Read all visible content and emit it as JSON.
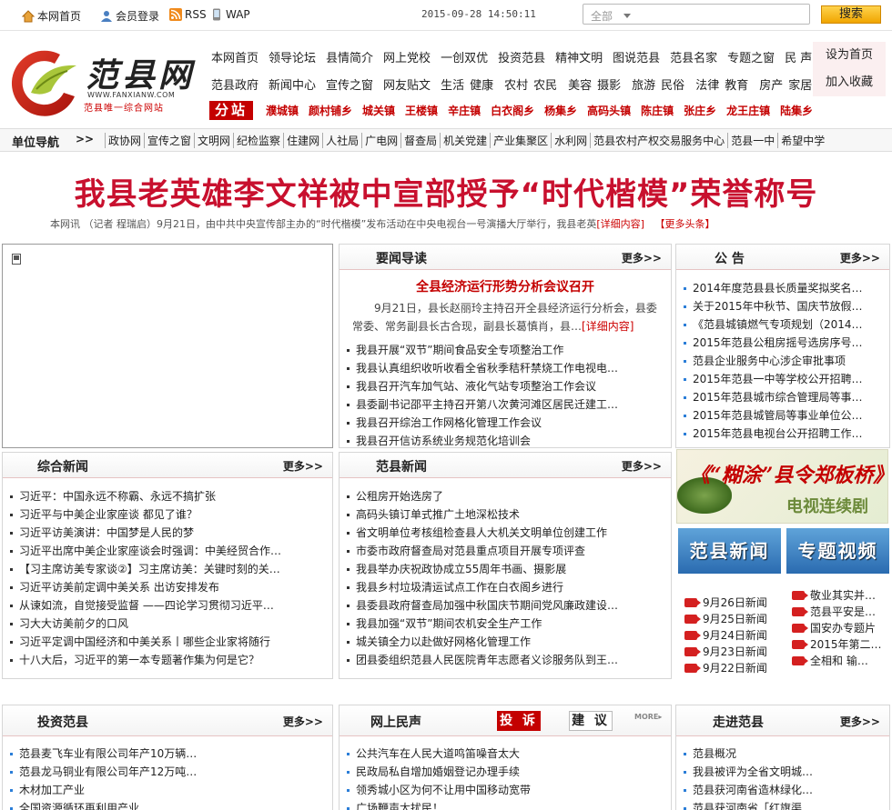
{
  "topbar": {
    "home": "本网首页",
    "login": "会员登录",
    "rss": "RSS",
    "wap": "WAP",
    "datetime": "2015-09-28 14:50:11",
    "search_scope": "全部",
    "search_button": "搜索"
  },
  "logo": {
    "name": "范县网",
    "url": "WWW.FANXIANW.COM",
    "slogan": "范县唯一综合网站"
  },
  "nav": {
    "row1": [
      "本网首页",
      "领导论坛",
      "县情简介",
      "网上党校",
      "一创双优",
      "投资范县",
      "精神文明",
      "图说范县",
      "范县名家",
      "专题之窗",
      "民 声"
    ],
    "row2": [
      "范县政府",
      "新闻中心",
      "宣传之窗",
      "网友贴文",
      "生活",
      "健康",
      "农村",
      "农民",
      "美容",
      "摄影",
      "旅游",
      "民俗",
      "法律",
      "教育",
      "房产",
      "家居"
    ],
    "set_home": "设为首页",
    "add_fav": "加入收藏",
    "fenzhan": "分站",
    "towns": [
      "濮城镇",
      "颜村铺乡",
      "城关镇",
      "王楼镇",
      "辛庄镇",
      "白衣阁乡",
      "杨集乡",
      "高码头镇",
      "陈庄镇",
      "张庄乡",
      "龙王庄镇",
      "陆集乡"
    ]
  },
  "unitnav": {
    "title": "单位导航",
    "arrow": ">>",
    "items": [
      "政协网",
      "宣传之窗",
      "文明网",
      "纪检监察",
      "住建网",
      "人社局",
      "广电网",
      "督查局",
      "机关党建",
      "产业集聚区",
      "水利网",
      "范县农村产权交易服务中心",
      "范县一中",
      "希望中学"
    ]
  },
  "headline": {
    "title": "我县老英雄李文祥被中宣部授予“时代楷模”荣誉称号",
    "summary": "本网讯 （记者 程瑞启）9月21日，由中共中央宣传部主办的“时代楷模”发布活动在中央电视台一号演播大厅举行，我县老英",
    "detail": "[详细内容]",
    "more": "【更多头条】"
  },
  "yaowen": {
    "title": "要闻导读",
    "more": "更多>>",
    "feature_title": "全县经济运行形势分析会议召开",
    "feature_summary": "9月21日，县长赵丽玲主持召开全县经济运行分析会，县委常委、常务副县长古合现，副县长葛慎肖，县…",
    "feature_detail": "[详细内容]",
    "items": [
      "我县开展“双节”期间食品安全专项整治工作",
      "我县认真组织收听收看全省秋季秸秆禁烧工作电视电…",
      "我县召开汽车加气站、液化气站专项整治工作会议",
      "县委副书记邵平主持召开第八次黄河滩区居民迁建工…",
      "我县召开综治工作网格化管理工作会议",
      "我县召开信访系统业务规范化培训会"
    ]
  },
  "gonggao": {
    "title": "公 告",
    "more": "更多>>",
    "items": [
      "2014年度范县县长质量奖拟奖名…",
      "关于2015年中秋节、国庆节放假…",
      "《范县城镇燃气专项规划（2014…",
      "2015年范县公租房摇号选房序号…",
      "范县企业服务中心涉企审批事项",
      "2015年范县一中等学校公开招聘…",
      "2015年范县城市综合管理局等事…",
      "2015年范县城管局等事业单位公…",
      "2015年范县电视台公开招聘工作…"
    ]
  },
  "zonghe": {
    "title": "综合新闻",
    "more": "更多>>",
    "items": [
      "习近平：中国永远不称霸、永远不搞扩张",
      "习近平与中美企业家座谈 都见了谁？",
      "习近平访美演讲：中国梦是人民的梦",
      "习近平出席中美企业家座谈会时强调：中美经贸合作…",
      "【习主席访美专家谈②】习主席访美：关键时刻的关…",
      "习近平访美前定调中美关系 出访安排发布",
      "从谏如流，自觉接受监督 ——四论学习贯彻习近平…",
      "习大大访美前夕的口风",
      "习近平定调中国经济和中美关系丨哪些企业家将随行",
      "十八大后，习近平的第一本专题著作集为何是它？"
    ]
  },
  "fanxian": {
    "title": "范县新闻",
    "more": "更多>>",
    "items": [
      "公租房开始选房了",
      "高码头镇订单式推广土地深松技术",
      "省文明单位考核组检查县人大机关文明单位创建工作",
      "市委市政府督查局对范县重点项目开展专项评查",
      "我县举办庆祝政协成立55周年书画、摄影展",
      "我县乡村垃圾清运试点工作在白衣阁乡进行",
      "县委县政府督查局加强中秋国庆节期间党风廉政建设…",
      "我县加强“双节”期间农机安全生产工作",
      "城关镇全力以赴做好网格化管理工作",
      "团县委组织范县人民医院青年志愿者义诊服务队到王…"
    ]
  },
  "banner": {
    "title": "《“糊涂”县令郑板桥》",
    "subtitle": "电视连续剧"
  },
  "tiles": {
    "news": "范县新闻",
    "video": "专题视频"
  },
  "video_dates": [
    "9月26日新闻",
    "9月25日新闻",
    "9月24日新闻",
    "9月23日新闻",
    "9月22日新闻"
  ],
  "video_topics": [
    "敬业其实并…",
    "范县平安是…",
    "国安办专题片",
    "2015年第二…",
    "全相和 输…"
  ],
  "touzi": {
    "title": "投资范县",
    "more": "更多>>",
    "items": [
      "范县麦飞车业有限公司年产10万辆…",
      "范县龙马铜业有限公司年产12万吨…",
      "木材加工产业",
      "全国资源循环再利用产业"
    ]
  },
  "minsheng": {
    "title": "网上民声",
    "tab_complaint": "投 诉",
    "tab_suggest": "建 议",
    "more": "MORE▸",
    "items": [
      "公共汽车在人民大道鸣笛噪音太大",
      "民政局私自增加婚姻登记办理手续",
      "领秀城小区为何不让用中国移动宽带",
      "广场鞭声太扰民！"
    ]
  },
  "zoujin": {
    "title": "走进范县",
    "more": "更多>>",
    "items": [
      "范县概况",
      "我县被评为全省文明城…",
      "范县获河南省造林绿化…",
      "范县获河南省「红旗渠…"
    ]
  },
  "colors": {
    "brand_red": "#c40000",
    "headline_red": "#c8102e",
    "accent_blue": "#2a6bb0"
  }
}
